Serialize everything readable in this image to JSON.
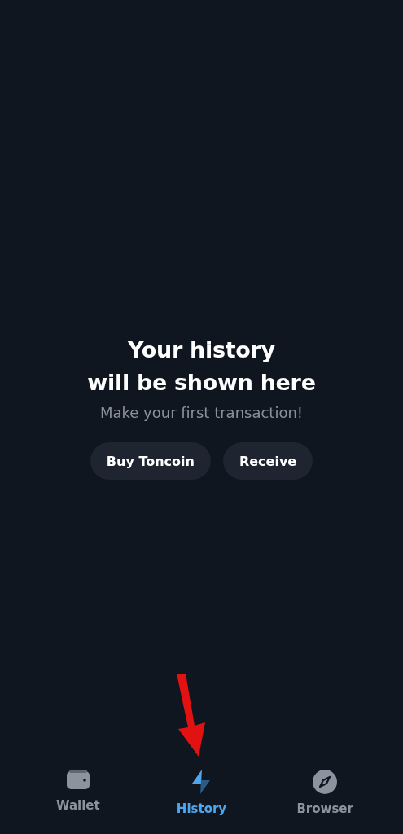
{
  "empty_state": {
    "title_lines": [
      "Your history",
      "will be shown here"
    ],
    "subtitle": "Make your first transaction!",
    "buttons": [
      "Buy Toncoin",
      "Receive"
    ]
  },
  "tab_bar": [
    {
      "kind": "wallet",
      "label": "Wallet",
      "selected": false
    },
    {
      "kind": "history",
      "label": "History",
      "selected": true
    },
    {
      "kind": "browser",
      "label": "Browser",
      "selected": false
    }
  ]
}
